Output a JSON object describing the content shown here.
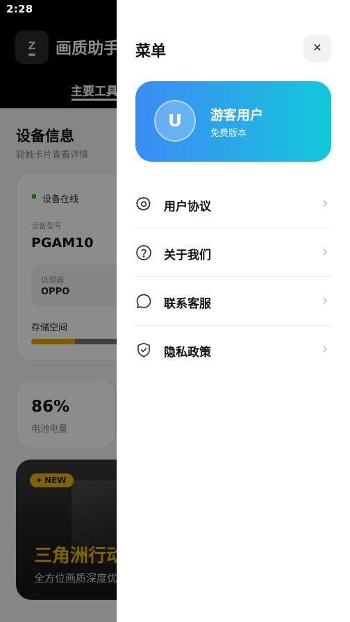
{
  "status_bar": {
    "time": "2:28"
  },
  "background_app": {
    "icon_letter": "Z",
    "title": "画质助手",
    "active_tab": "主要工具",
    "section_title": "设备信息",
    "section_subtitle": "轻触卡片查看详情",
    "device_card": {
      "status": "设备在线",
      "model_label": "设备型号",
      "model_value": "PGAM10",
      "cpu_label": "处理器",
      "cpu_value": "OPPO",
      "storage_label": "存储空间",
      "storage_used_fraction": 0.35
    },
    "battery_card": {
      "value": "86%",
      "label": "电池电量"
    },
    "promo_card": {
      "badge": "NEW",
      "title": "三角洲行动",
      "subtitle": "全方位画质深度优化"
    },
    "colors": {
      "online": "#1fb81f",
      "accent": "#e6b400"
    }
  },
  "drawer": {
    "title": "菜单",
    "close_icon": "close-icon",
    "user": {
      "avatar_letter": "U",
      "name": "游客用户",
      "plan": "免费版本",
      "gradient": [
        "#3b8cf5",
        "#12c8d8"
      ]
    },
    "items": [
      {
        "label": "用户协议",
        "icon": "gear-icon"
      },
      {
        "label": "关于我们",
        "icon": "help-circle-icon"
      },
      {
        "label": "联系客服",
        "icon": "chat-bubble-icon"
      },
      {
        "label": "隐私政策",
        "icon": "shield-check-icon"
      }
    ]
  }
}
